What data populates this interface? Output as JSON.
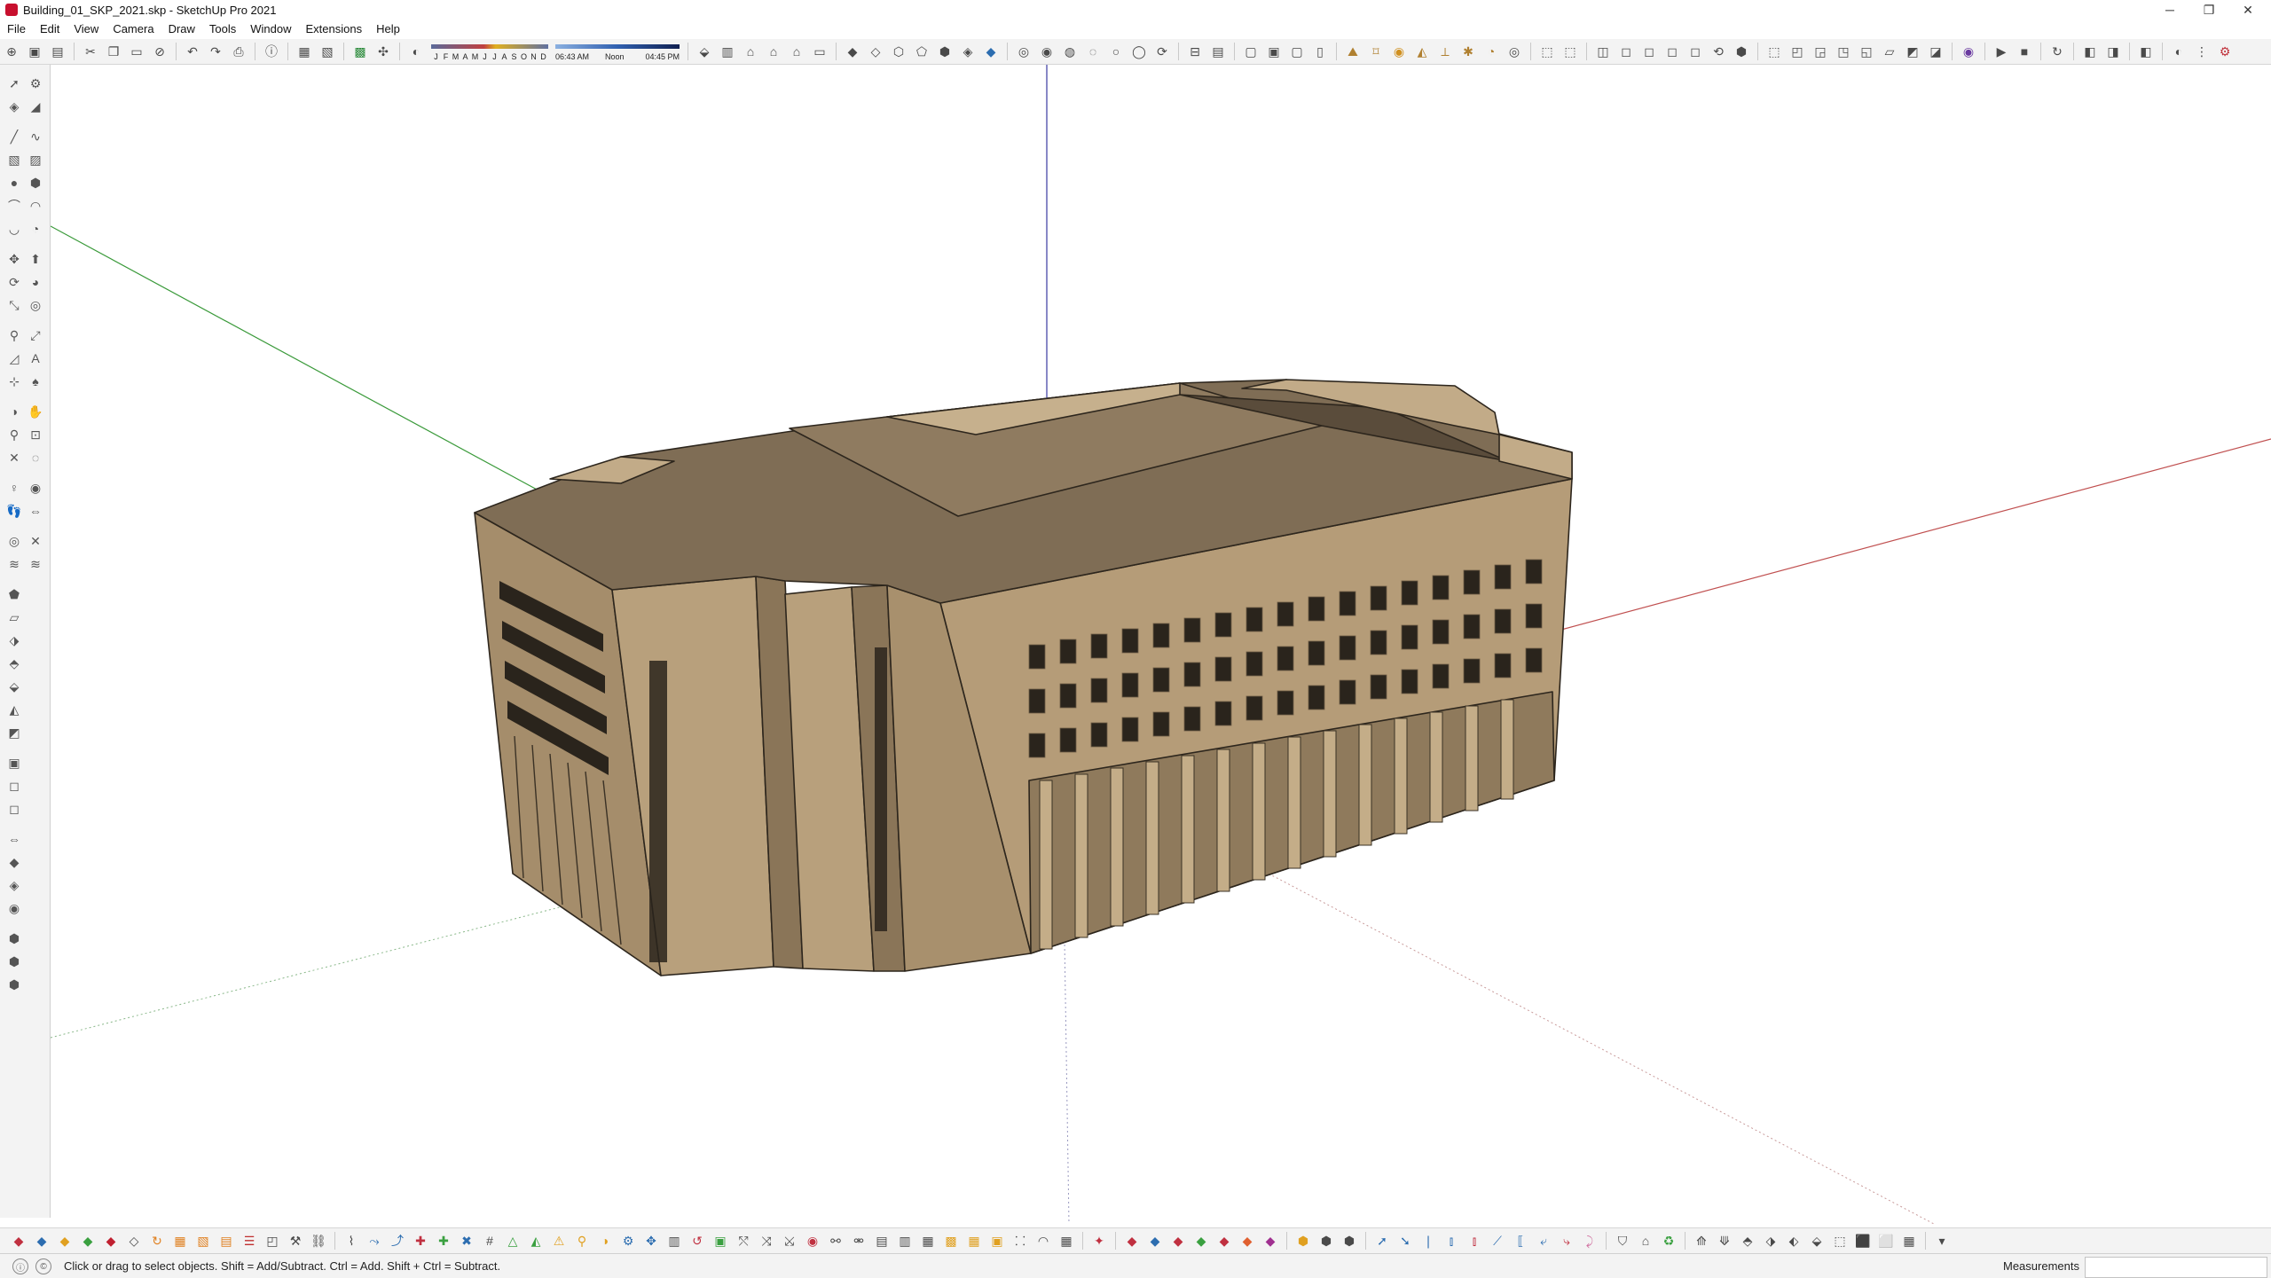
{
  "window": {
    "title": "Building_01_SKP_2021.skp - SketchUp Pro 2021",
    "controls": [
      "─",
      "❐",
      "✕"
    ]
  },
  "menu": [
    "File",
    "Edit",
    "View",
    "Camera",
    "Draw",
    "Tools",
    "Window",
    "Extensions",
    "Help"
  ],
  "shadows": {
    "months": [
      "J",
      "F",
      "M",
      "A",
      "M",
      "J",
      "J",
      "A",
      "S",
      "O",
      "N",
      "D"
    ],
    "time_start": "06:43 AM",
    "time_mid": "Noon",
    "time_end": "04:45 PM"
  },
  "toolbar_icons": [
    "select-icon",
    "paint-bucket-icon",
    "eraser-icon",
    "line-icon",
    "rectangle-icon",
    "circle-icon",
    "arc-icon",
    "push-pull-icon",
    "move-icon",
    "rotate-icon",
    "scale-icon",
    "offset-icon",
    "tape-measure-icon",
    "text-icon",
    "orbit-icon",
    "pan-icon",
    "zoom-icon",
    "zoom-extents-icon",
    "section-plane-icon",
    "undo-icon",
    "redo-icon",
    "print-icon",
    "model-info-icon",
    "styles-icon",
    "shadows-icon",
    "xray-icon",
    "wireframe-icon",
    "hidden-line-icon",
    "shaded-icon",
    "iso-view-icon",
    "top-view-icon",
    "front-view-icon",
    "right-view-icon",
    "back-view-icon",
    "left-view-icon",
    "warehouse-icon",
    "extension-icon",
    "play-icon",
    "stop-icon"
  ],
  "status": {
    "message": "Click or drag to select objects. Shift = Add/Subtract. Ctrl = Add. Shift + Ctrl = Subtract.",
    "measurements_label": "Measurements",
    "measurements_value": ""
  },
  "colors": {
    "building_main": "#b59c78",
    "building_roof": "#7f6d55",
    "building_dark": "#5a4c3b",
    "axis_red": "#c05050",
    "axis_green": "#3a9a3a",
    "axis_blue": "#3a3aa0"
  }
}
